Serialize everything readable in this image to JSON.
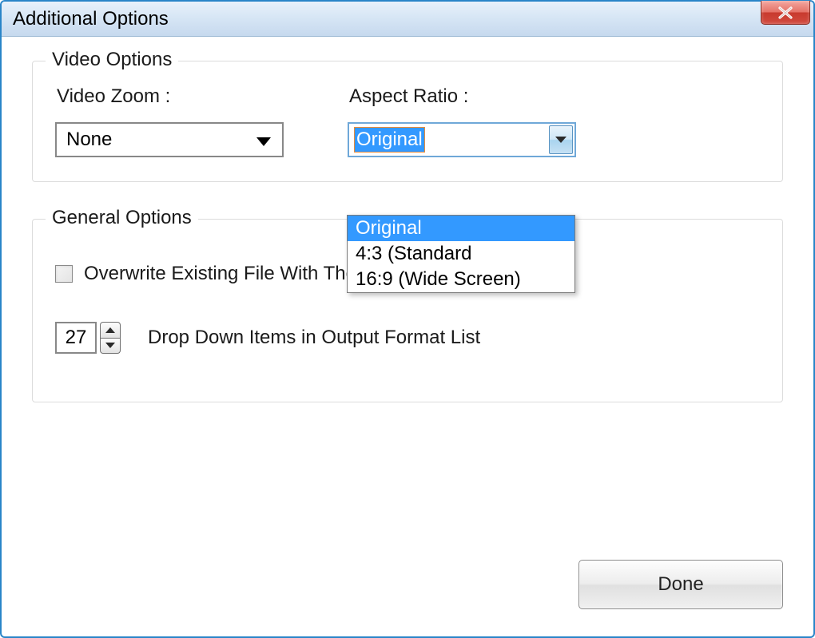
{
  "window": {
    "title": "Additional Options"
  },
  "video_options": {
    "legend": "Video Options",
    "zoom_label": "Video Zoom :",
    "zoom_value": "None",
    "aspect_label": "Aspect Ratio :",
    "aspect_value": "Original",
    "aspect_options": [
      "Original",
      "4:3 (Standard",
      "16:9 (Wide Screen)"
    ]
  },
  "general_options": {
    "legend": "General Options",
    "overwrite_label": "Overwrite Existing File With The Same Name",
    "overwrite_checked": false,
    "dropdown_count": "27",
    "dropdown_label": "Drop Down Items in Output Format List"
  },
  "buttons": {
    "done": "Done"
  }
}
